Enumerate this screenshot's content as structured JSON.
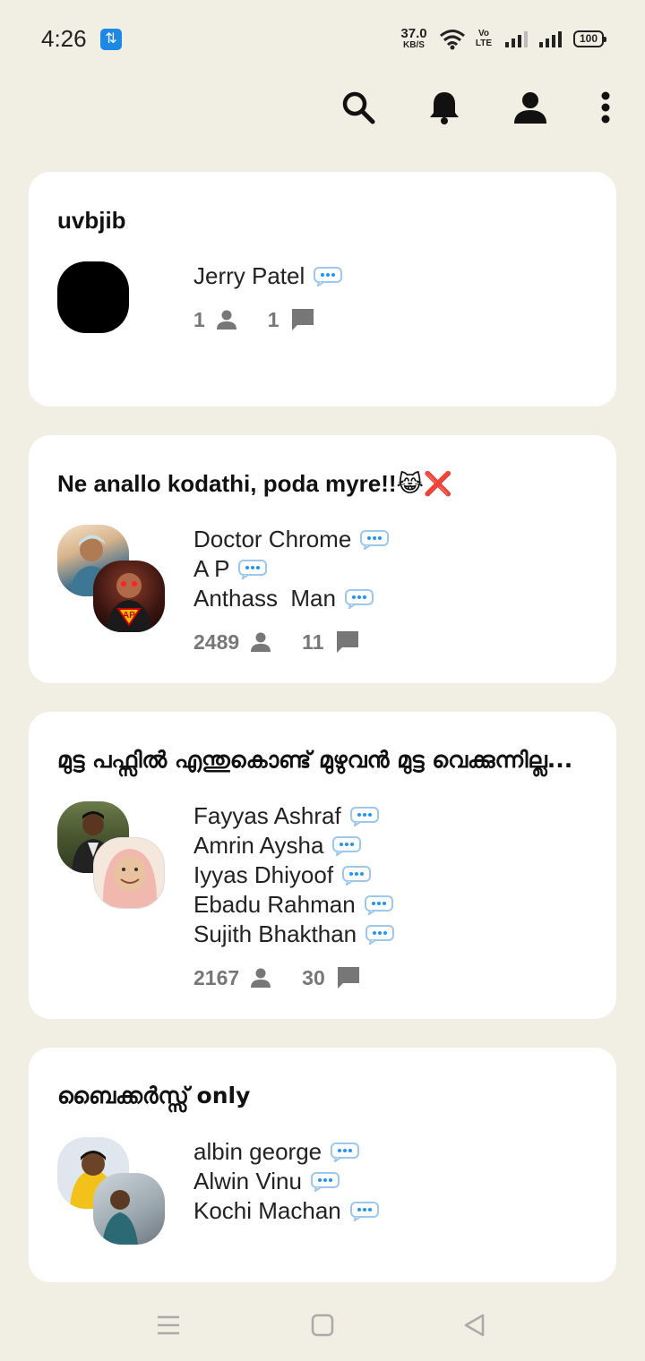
{
  "status_bar": {
    "time": "4:26",
    "net_speed_value": "37.0",
    "net_speed_unit": "KB/S",
    "volte_label": "Vo LTE",
    "battery": "100"
  },
  "top_bar": {
    "icons": [
      "search-icon",
      "bell-icon",
      "person-icon",
      "more-vert-icon"
    ]
  },
  "groups": [
    {
      "title": "uvbjib",
      "members": [
        "Jerry Patel"
      ],
      "member_count": "1",
      "message_count": "1"
    },
    {
      "title": "Ne anallo kodathi, poda myre!!😹❌",
      "members": [
        "Doctor Chrome",
        "A P",
        "Anthass  Man"
      ],
      "member_count": "2489",
      "message_count": "11"
    },
    {
      "title": "മുട്ട പഫ്സിൽ എന്തുകൊണ്ട് മുഴുവൻ മുട്ട വെക്കുന്നില്ല...",
      "members": [
        "Fayyas Ashraf",
        "Amrin Aysha",
        "Iyyas Dhiyoof",
        "Ebadu Rahman",
        "Sujith Bhakthan"
      ],
      "member_count": "2167",
      "message_count": "30"
    },
    {
      "title": "ബൈക്കർസ്സ് only",
      "members": [
        "albin george",
        "Alwin Vinu",
        "Kochi Machan"
      ]
    }
  ],
  "nav_bar": {
    "icons": [
      "menu-icon",
      "home-icon",
      "back-icon"
    ]
  },
  "colors": {
    "background": "#f1efe3",
    "card": "#ffffff",
    "stat_text": "#777777",
    "chat_bubble": "#2196f3"
  }
}
